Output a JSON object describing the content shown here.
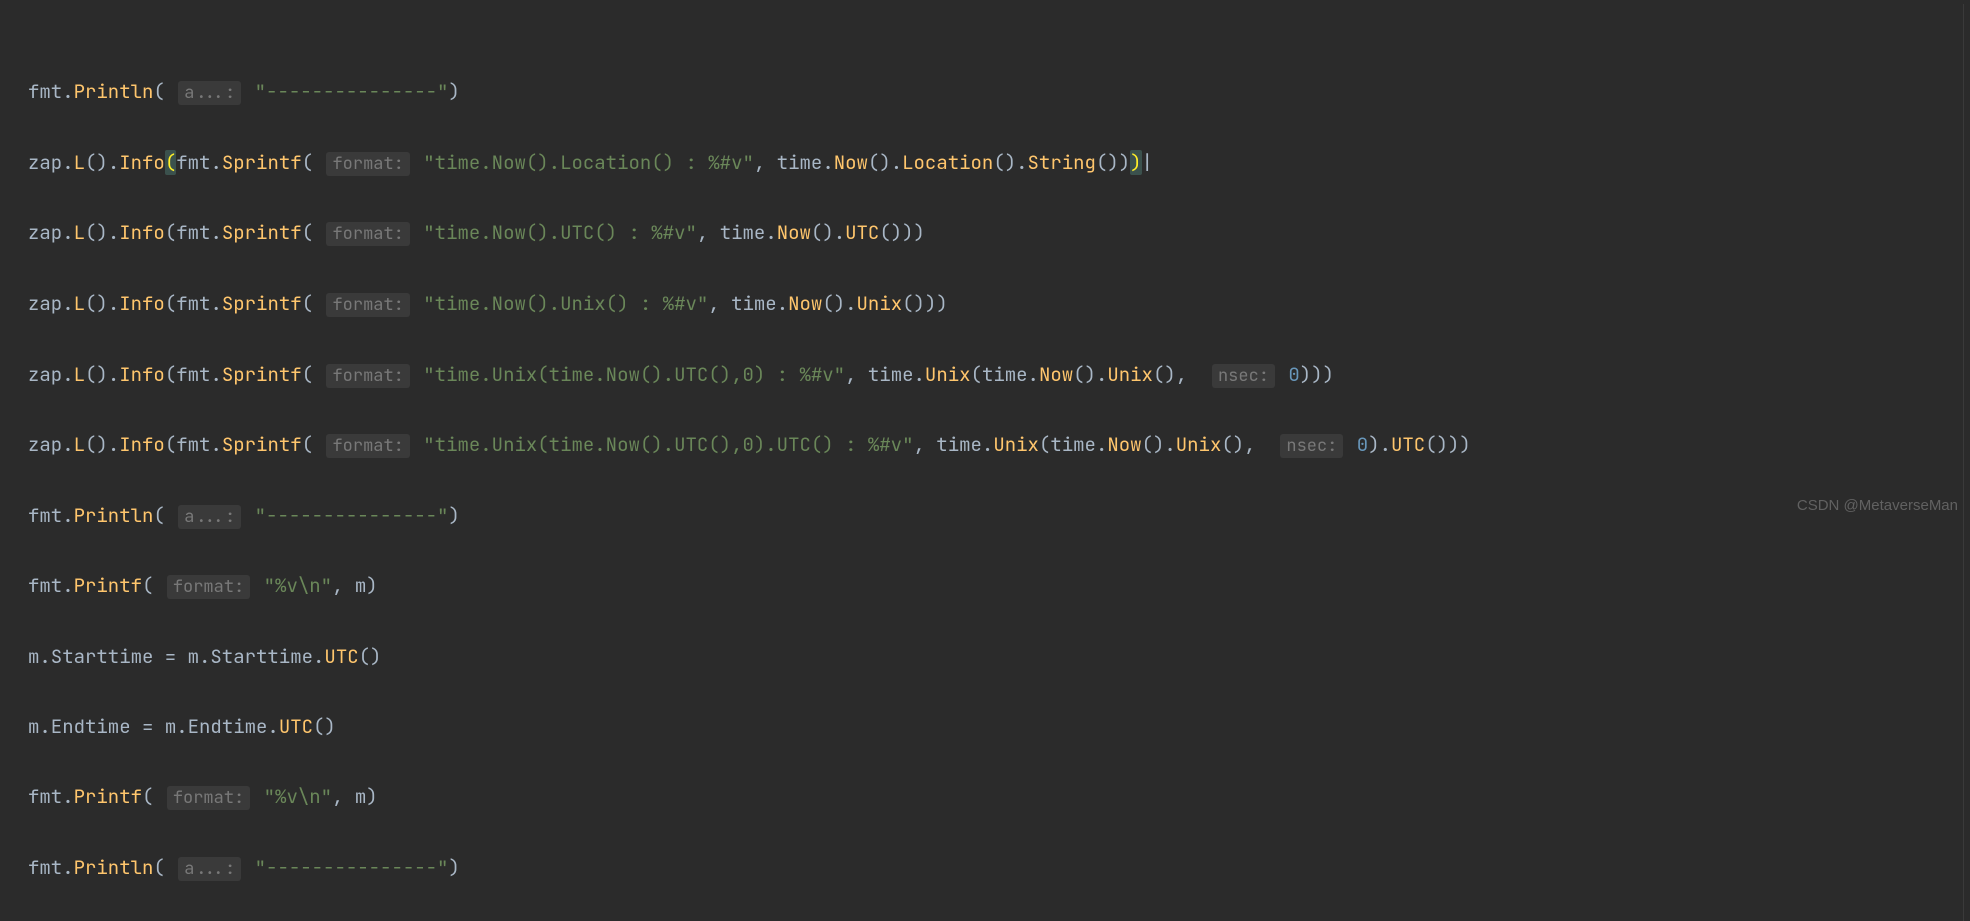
{
  "watermark": "CSDN @MetaverseMan",
  "hints": {
    "a": "a...:",
    "format": "format:",
    "nsec": "nsec:"
  },
  "lines": {
    "l1": {
      "fmt": "fmt",
      "println": "Println",
      "str": "\"---------------\""
    },
    "l2": {
      "zap": "zap",
      "L": "L",
      "Info": "Info",
      "fmt": "fmt",
      "Sprintf": "Sprintf",
      "str": "\"time.Now().Location() : %#v\"",
      "time": "time",
      "Now": "Now",
      "Location": "Location",
      "String": "String"
    },
    "l3": {
      "zap": "zap",
      "L": "L",
      "Info": "Info",
      "fmt": "fmt",
      "Sprintf": "Sprintf",
      "str": "\"time.Now().UTC() : %#v\"",
      "time": "time",
      "Now": "Now",
      "UTC": "UTC"
    },
    "l4": {
      "zap": "zap",
      "L": "L",
      "Info": "Info",
      "fmt": "fmt",
      "Sprintf": "Sprintf",
      "str": "\"time.Now().Unix() : %#v\"",
      "time": "time",
      "Now": "Now",
      "Unix": "Unix"
    },
    "l5": {
      "zap": "zap",
      "L": "L",
      "Info": "Info",
      "fmt": "fmt",
      "Sprintf": "Sprintf",
      "str": "\"time.Unix(time.Now().UTC(),0) : %#v\"",
      "time": "time",
      "Unix": "Unix",
      "Now": "Now",
      "zero": "0"
    },
    "l6": {
      "zap": "zap",
      "L": "L",
      "Info": "Info",
      "fmt": "fmt",
      "Sprintf": "Sprintf",
      "str": "\"time.Unix(time.Now().UTC(),0).UTC() : %#v\"",
      "time": "time",
      "Unix": "Unix",
      "Now": "Now",
      "UTC": "UTC",
      "zero": "0"
    },
    "l7": {
      "fmt": "fmt",
      "println": "Println",
      "str": "\"---------------\""
    },
    "l8": {
      "fmt": "fmt",
      "printf": "Printf",
      "str": "\"%v\\n\"",
      "m": "m"
    },
    "l9": {
      "lhs": "m.Starttime",
      "eq": " = ",
      "rhs_m": "m.Starttime.",
      "UTC": "UTC"
    },
    "l10": {
      "lhs": "m.Endtime",
      "eq": " = ",
      "rhs_m": "m.Endtime.",
      "UTC": "UTC"
    },
    "l11": {
      "fmt": "fmt",
      "printf": "Printf",
      "str": "\"%v\\n\"",
      "m": "m"
    },
    "l12": {
      "fmt": "fmt",
      "println": "Println",
      "str": "\"---------------\""
    }
  }
}
